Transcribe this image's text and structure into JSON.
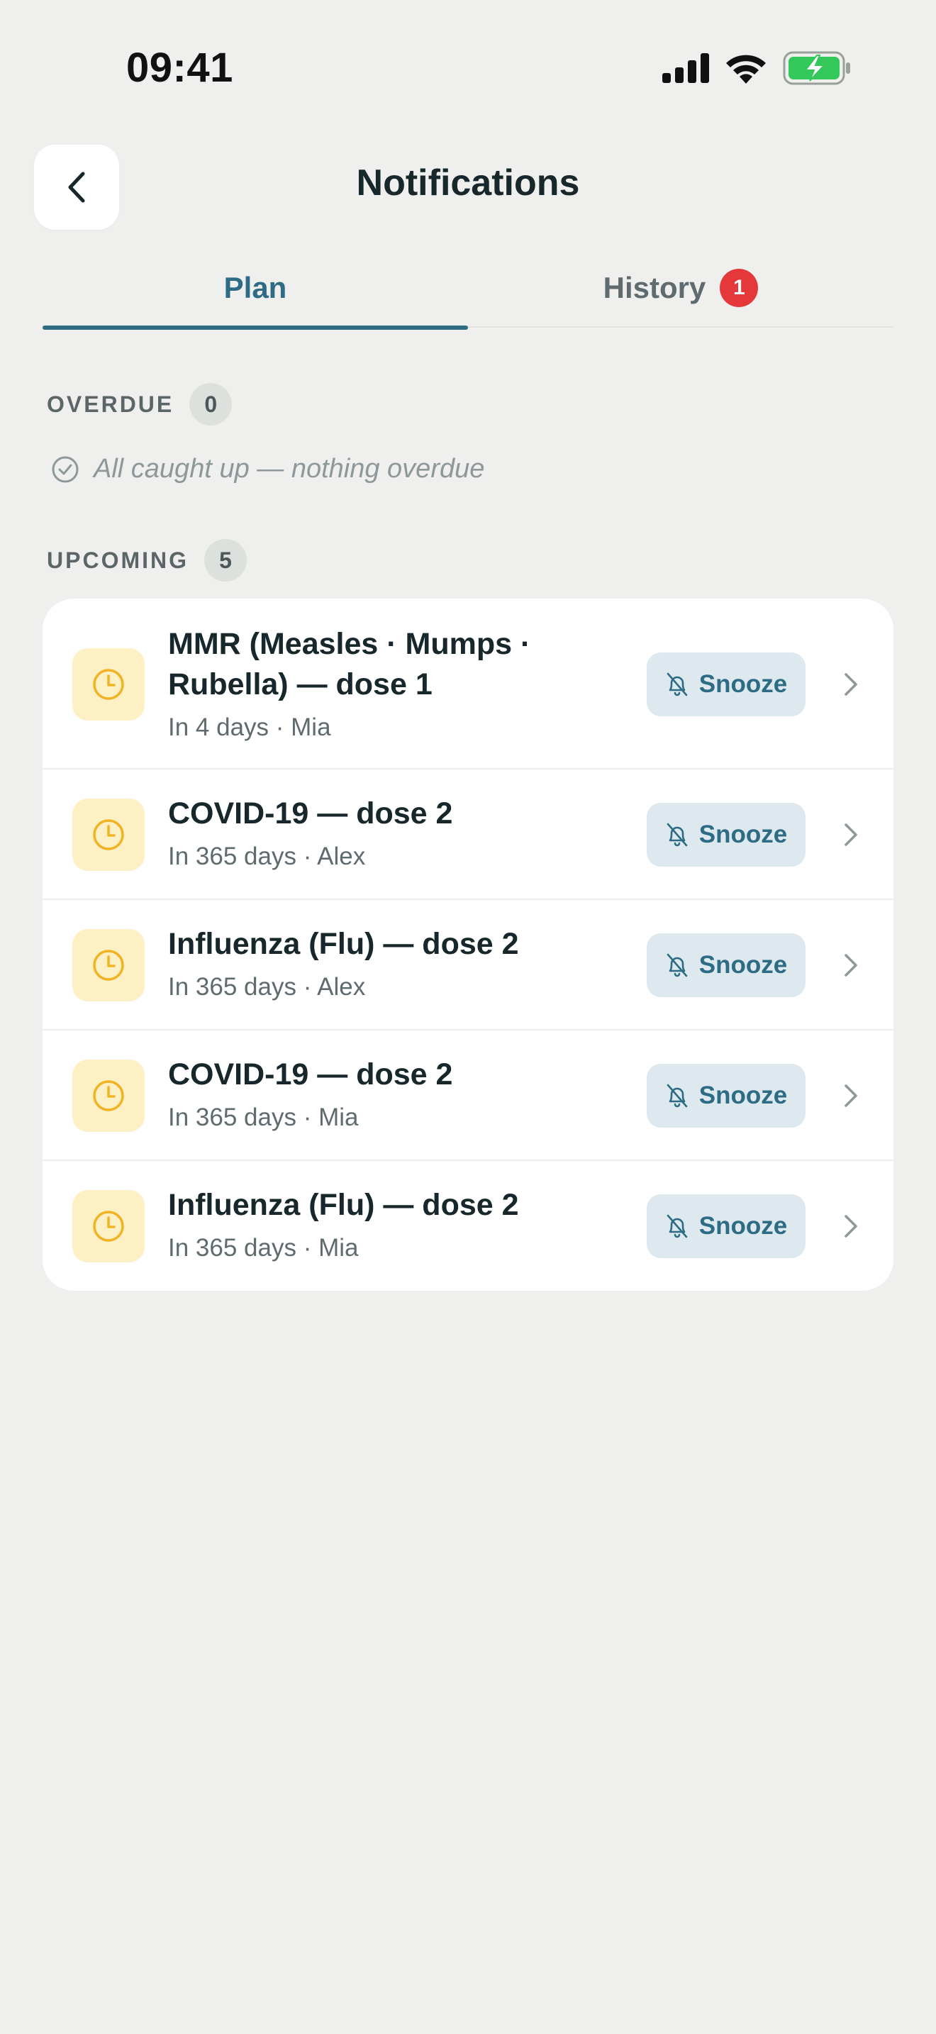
{
  "status_bar": {
    "time": "09:41",
    "icons": [
      "signal-icon",
      "wifi-icon",
      "battery-charging-icon"
    ]
  },
  "header": {
    "title": "Notifications",
    "back_icon": "chevron-left-icon"
  },
  "tabs": [
    {
      "label": "Plan",
      "active": true
    },
    {
      "label": "History",
      "active": false,
      "badge": "1"
    }
  ],
  "sections": {
    "overdue": {
      "title": "OVERDUE",
      "count": "0",
      "empty_text": "All caught up — nothing overdue",
      "empty_icon": "check-circle-icon"
    },
    "upcoming": {
      "title": "UPCOMING",
      "count": "5",
      "items": [
        {
          "title": "MMR (Measles · Mumps · Rubella) — dose 1",
          "subtitle": "In 4 days · Mia",
          "action": "Snooze",
          "icon": "clock-icon"
        },
        {
          "title": "COVID-19 — dose 2",
          "subtitle": "In 365 days · Alex",
          "action": "Snooze",
          "icon": "clock-icon"
        },
        {
          "title": "Influenza (Flu) — dose 2",
          "subtitle": "In 365 days · Alex",
          "action": "Snooze",
          "icon": "clock-icon"
        },
        {
          "title": "COVID-19 — dose 2",
          "subtitle": "In 365 days · Mia",
          "action": "Snooze",
          "icon": "clock-icon"
        },
        {
          "title": "Influenza (Flu) — dose 2",
          "subtitle": "In 365 days · Mia",
          "action": "Snooze",
          "icon": "clock-icon"
        }
      ]
    }
  },
  "colors": {
    "background": "#eff0ee",
    "accent": "#2e6b85",
    "badge_red": "#e5383b",
    "clock_yellow": "#f0b323",
    "clock_bg": "#fdf0c4",
    "snooze_bg": "#dde9ee",
    "battery_green": "#34c759"
  }
}
